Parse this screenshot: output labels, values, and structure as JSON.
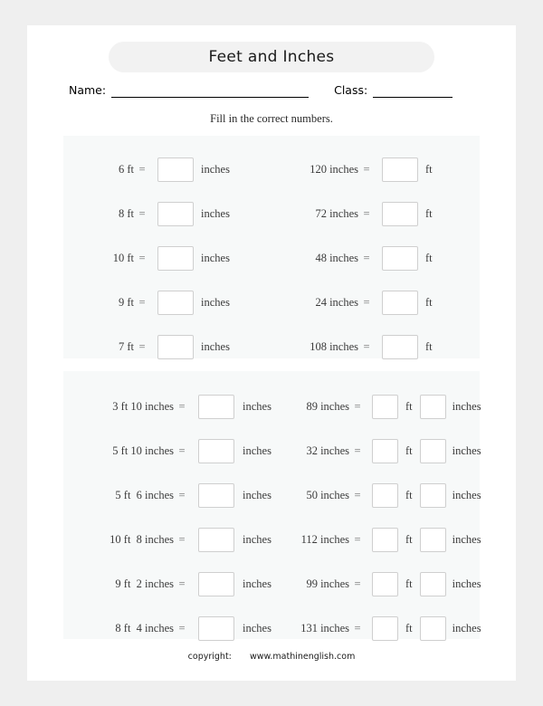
{
  "worksheet": {
    "title": "Feet and Inches",
    "name_label": "Name:",
    "class_label": "Class:",
    "instruction": "Fill in the correct numbers.",
    "copyright_label": "copyright:",
    "copyright_site": "www.mathinenglish.com"
  },
  "units": {
    "ft": "ft",
    "inches": "inches",
    "equals": "="
  },
  "section1": {
    "left": [
      {
        "prompt": "6 ft",
        "unit": "inches"
      },
      {
        "prompt": "8 ft",
        "unit": "inches"
      },
      {
        "prompt": "10 ft",
        "unit": "inches"
      },
      {
        "prompt": "9 ft",
        "unit": "inches"
      },
      {
        "prompt": "7 ft",
        "unit": "inches"
      }
    ],
    "right": [
      {
        "prompt": "120 inches",
        "unit": "ft"
      },
      {
        "prompt": "72 inches",
        "unit": "ft"
      },
      {
        "prompt": "48 inches",
        "unit": "ft"
      },
      {
        "prompt": "24 inches",
        "unit": "ft"
      },
      {
        "prompt": "108 inches",
        "unit": "ft"
      }
    ]
  },
  "section2": {
    "left": [
      {
        "prompt": "3 ft 10 inches",
        "unit": "inches"
      },
      {
        "prompt": "5 ft 10 inches",
        "unit": "inches"
      },
      {
        "prompt": "5 ft  6 inches",
        "unit": "inches"
      },
      {
        "prompt": "10 ft  8 inches",
        "unit": "inches"
      },
      {
        "prompt": "9 ft  2 inches",
        "unit": "inches"
      },
      {
        "prompt": "8 ft  4 inches",
        "unit": "inches"
      }
    ],
    "right": [
      {
        "prompt": "89 inches",
        "unit_a": "ft",
        "unit_b": "inches"
      },
      {
        "prompt": "32 inches",
        "unit_a": "ft",
        "unit_b": "inches"
      },
      {
        "prompt": "50 inches",
        "unit_a": "ft",
        "unit_b": "inches"
      },
      {
        "prompt": "112 inches",
        "unit_a": "ft",
        "unit_b": "inches"
      },
      {
        "prompt": "99 inches",
        "unit_a": "ft",
        "unit_b": "inches"
      },
      {
        "prompt": "131 inches",
        "unit_a": "ft",
        "unit_b": "inches"
      }
    ]
  }
}
